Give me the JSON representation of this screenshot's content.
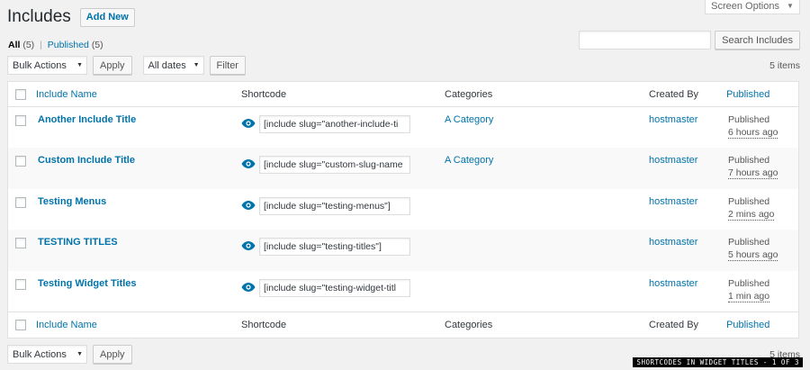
{
  "screen_options": {
    "label": "Screen Options",
    "caret": "▼"
  },
  "header": {
    "title": "Includes",
    "add_new": "Add New"
  },
  "views": {
    "all_label": "All",
    "all_count": "(5)",
    "sep": "|",
    "published_label": "Published",
    "published_count": "(5)"
  },
  "search": {
    "placeholder": "",
    "button": "Search Includes"
  },
  "tablenav_top": {
    "bulk_selected": "Bulk Actions",
    "apply": "Apply",
    "dates_selected": "All dates",
    "filter": "Filter",
    "items": "5 items"
  },
  "tablenav_bottom": {
    "bulk_selected": "Bulk Actions",
    "apply": "Apply",
    "items": "5 items"
  },
  "columns": {
    "name": "Include Name",
    "shortcode": "Shortcode",
    "categories": "Categories",
    "created_by": "Created By",
    "published": "Published"
  },
  "rows": [
    {
      "title": "Another Include Title",
      "shortcode": "[include slug=\"another-include-ti",
      "category": "A Category",
      "author": "hostmaster",
      "status": "Published",
      "ago": "6 hours ago"
    },
    {
      "title": "Custom Include Title",
      "shortcode": "[include slug=\"custom-slug-name",
      "category": "A Category",
      "author": "hostmaster",
      "status": "Published",
      "ago": "7 hours ago"
    },
    {
      "title": "Testing Menus",
      "shortcode": "[include slug=\"testing-menus\"]",
      "category": "",
      "author": "hostmaster",
      "status": "Published",
      "ago": "2 mins ago"
    },
    {
      "title": "TESTING TITLES",
      "shortcode": "[include slug=\"testing-titles\"]",
      "category": "",
      "author": "hostmaster",
      "status": "Published",
      "ago": "5 hours ago"
    },
    {
      "title": "Testing Widget Titles",
      "shortcode": "[include slug=\"testing-widget-titl",
      "category": "",
      "author": "hostmaster",
      "status": "Published",
      "ago": "1 min ago"
    }
  ],
  "caption": "SHORTCODES IN WIDGET TITLES - 1 OF 3",
  "colors": {
    "link": "#0073aa",
    "background": "#f1f1f1",
    "eye_icon": "#0073aa"
  },
  "icons": {
    "row_view": "eye-icon"
  }
}
